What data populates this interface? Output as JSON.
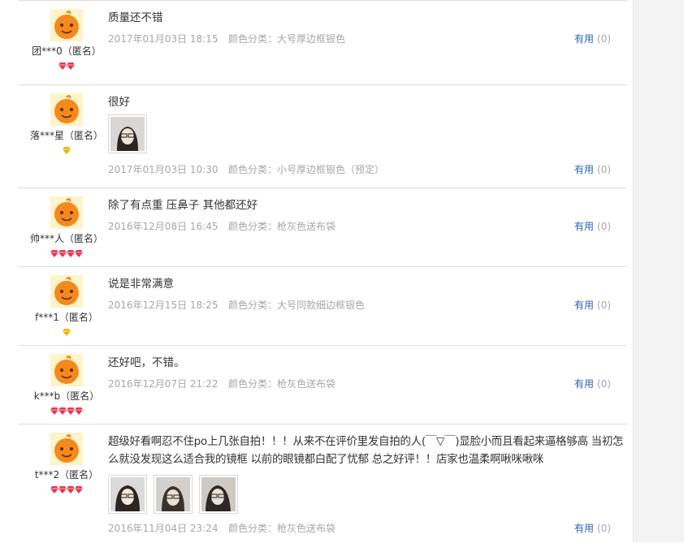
{
  "reviews": [
    {
      "user": "团***0（匿名）",
      "badge": "red",
      "badge_count": 2,
      "text": "质量还不错",
      "date": "2017年01月03日 18:15",
      "color": "颜色分类：大号厚边框银色",
      "useful": "有用",
      "count": "(0)",
      "photos": 0
    },
    {
      "user": "落***星（匿名）",
      "badge": "gold",
      "badge_count": 1,
      "text": "很好",
      "date": "2017年01月03日 10:30",
      "color": "颜色分类：小号厚边框银色（预定）",
      "useful": "有用",
      "count": "(0)",
      "photos": 1
    },
    {
      "user": "帅***人（匿名）",
      "badge": "red",
      "badge_count": 4,
      "text": "除了有点重 压鼻子 其他都还好",
      "date": "2016年12月08日 16:45",
      "color": "颜色分类：枪灰色送布袋",
      "useful": "有用",
      "count": "(0)",
      "photos": 0
    },
    {
      "user": "f***1（匿名）",
      "badge": "gold",
      "badge_count": 1,
      "text": "说是非常满意",
      "date": "2016年12月15日 18:25",
      "color": "颜色分类：大号同款细边框银色",
      "useful": "有用",
      "count": "(0)",
      "photos": 0
    },
    {
      "user": "k***b（匿名）",
      "badge": "red",
      "badge_count": 4,
      "text": "还好吧，不错。",
      "date": "2016年12月07日 21:22",
      "color": "颜色分类：枪灰色送布袋",
      "useful": "有用",
      "count": "(0)",
      "photos": 0
    },
    {
      "user": "t***2（匿名）",
      "badge": "red",
      "badge_count": 4,
      "text": "超级好看啊忍不住po上几张自拍！！！从来不在评价里发自拍的人(￣▽￣)显脸小而且看起来逼格够高 当初怎么就没发现这么适合我的镜框 以前的眼镜都白配了忧郁 总之好评！！店家也温柔啊啾咪啾咪",
      "date": "2016年11月04日 23:24",
      "color": "颜色分类：枪灰色送布袋",
      "useful": "有用",
      "count": "(0)",
      "photos": 3
    }
  ]
}
